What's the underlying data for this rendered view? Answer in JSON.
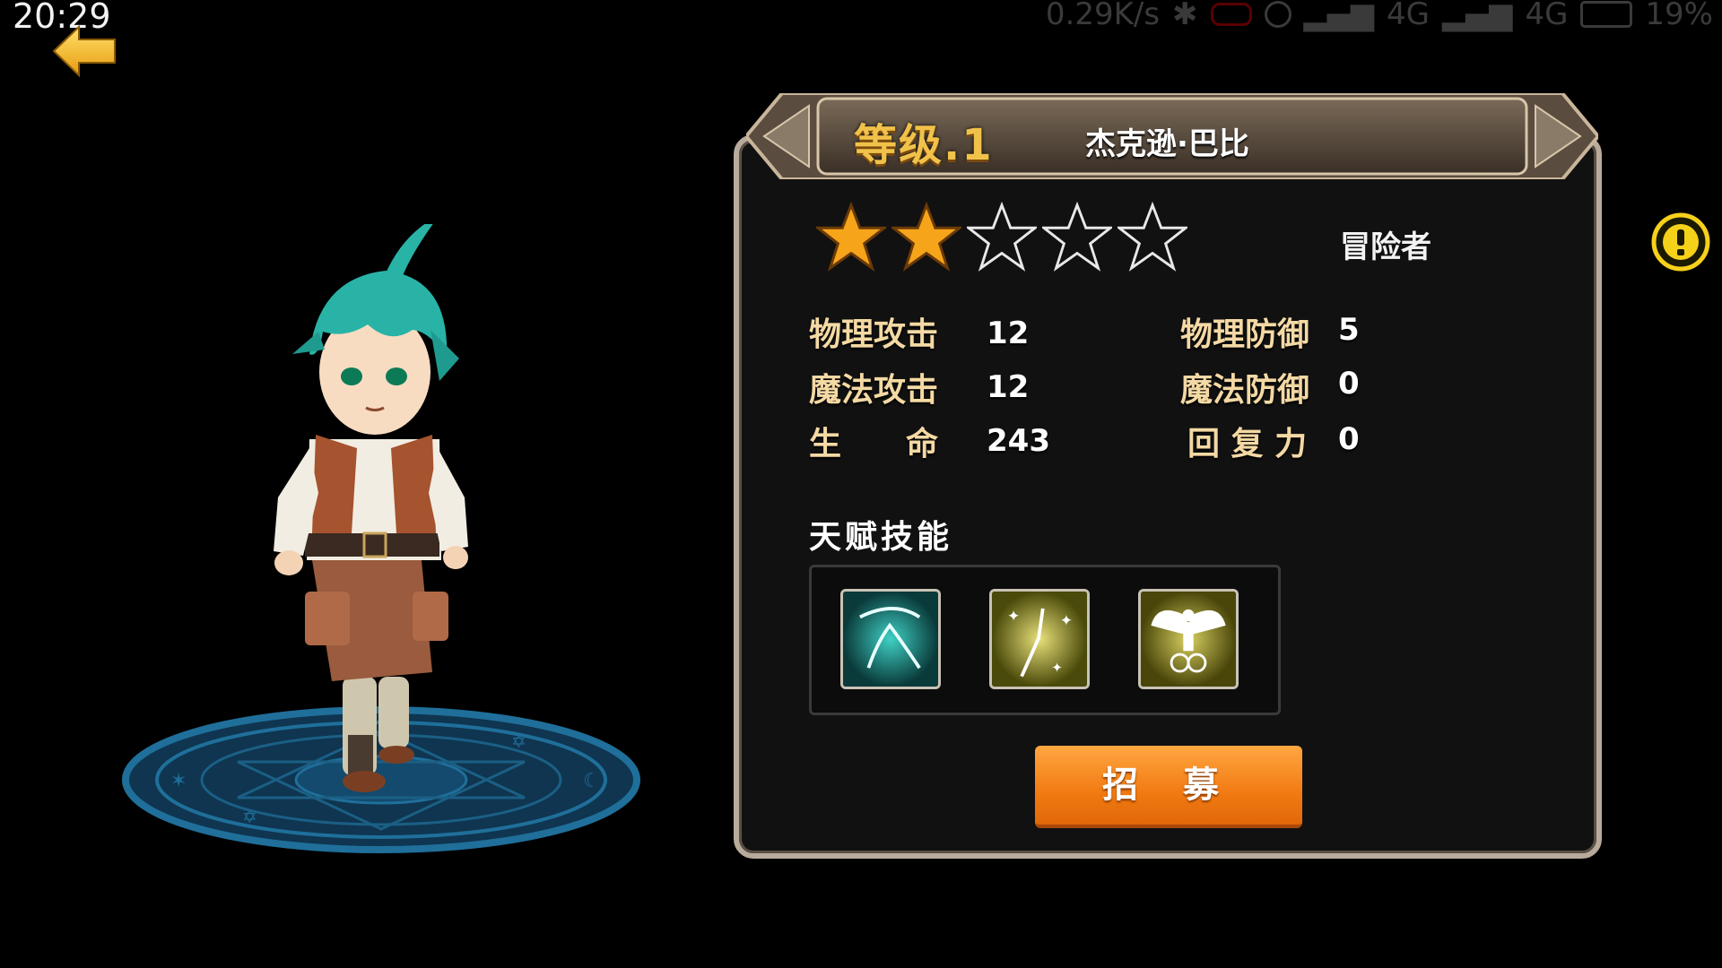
{
  "status_bar": {
    "time": "20:29",
    "net_speed": "0.29K/s",
    "network1": "4G",
    "network2": "4G",
    "battery": "19%"
  },
  "hero": {
    "level_label": "等级.1",
    "name": "杰克逊·巴比",
    "stars_filled": 2,
    "stars_total": 5,
    "class": "冒险者"
  },
  "stats": [
    {
      "label": "物理攻击",
      "value": "12"
    },
    {
      "label": "魔法攻击",
      "value": "12"
    },
    {
      "label": "生　　命",
      "value": "243"
    },
    {
      "label": "物理防御",
      "value": "5"
    },
    {
      "label": "魔法防御",
      "value": "0"
    },
    {
      "label": "回 复 力",
      "value": "0"
    }
  ],
  "talent": {
    "title": "天赋技能",
    "skills": [
      {
        "icon": "wind-slash-skill-icon",
        "color": "#1fa9a0"
      },
      {
        "icon": "star-strike-skill-icon",
        "color": "#a9a11d"
      },
      {
        "icon": "angel-wing-skill-icon",
        "color": "#b1a82a"
      }
    ]
  },
  "recruit_button": "招 募",
  "colors": {
    "level": "#f1c24a",
    "recruit": "#f27a12",
    "magic_circle": "#1f6f9a",
    "hair": "#29b3a7"
  }
}
